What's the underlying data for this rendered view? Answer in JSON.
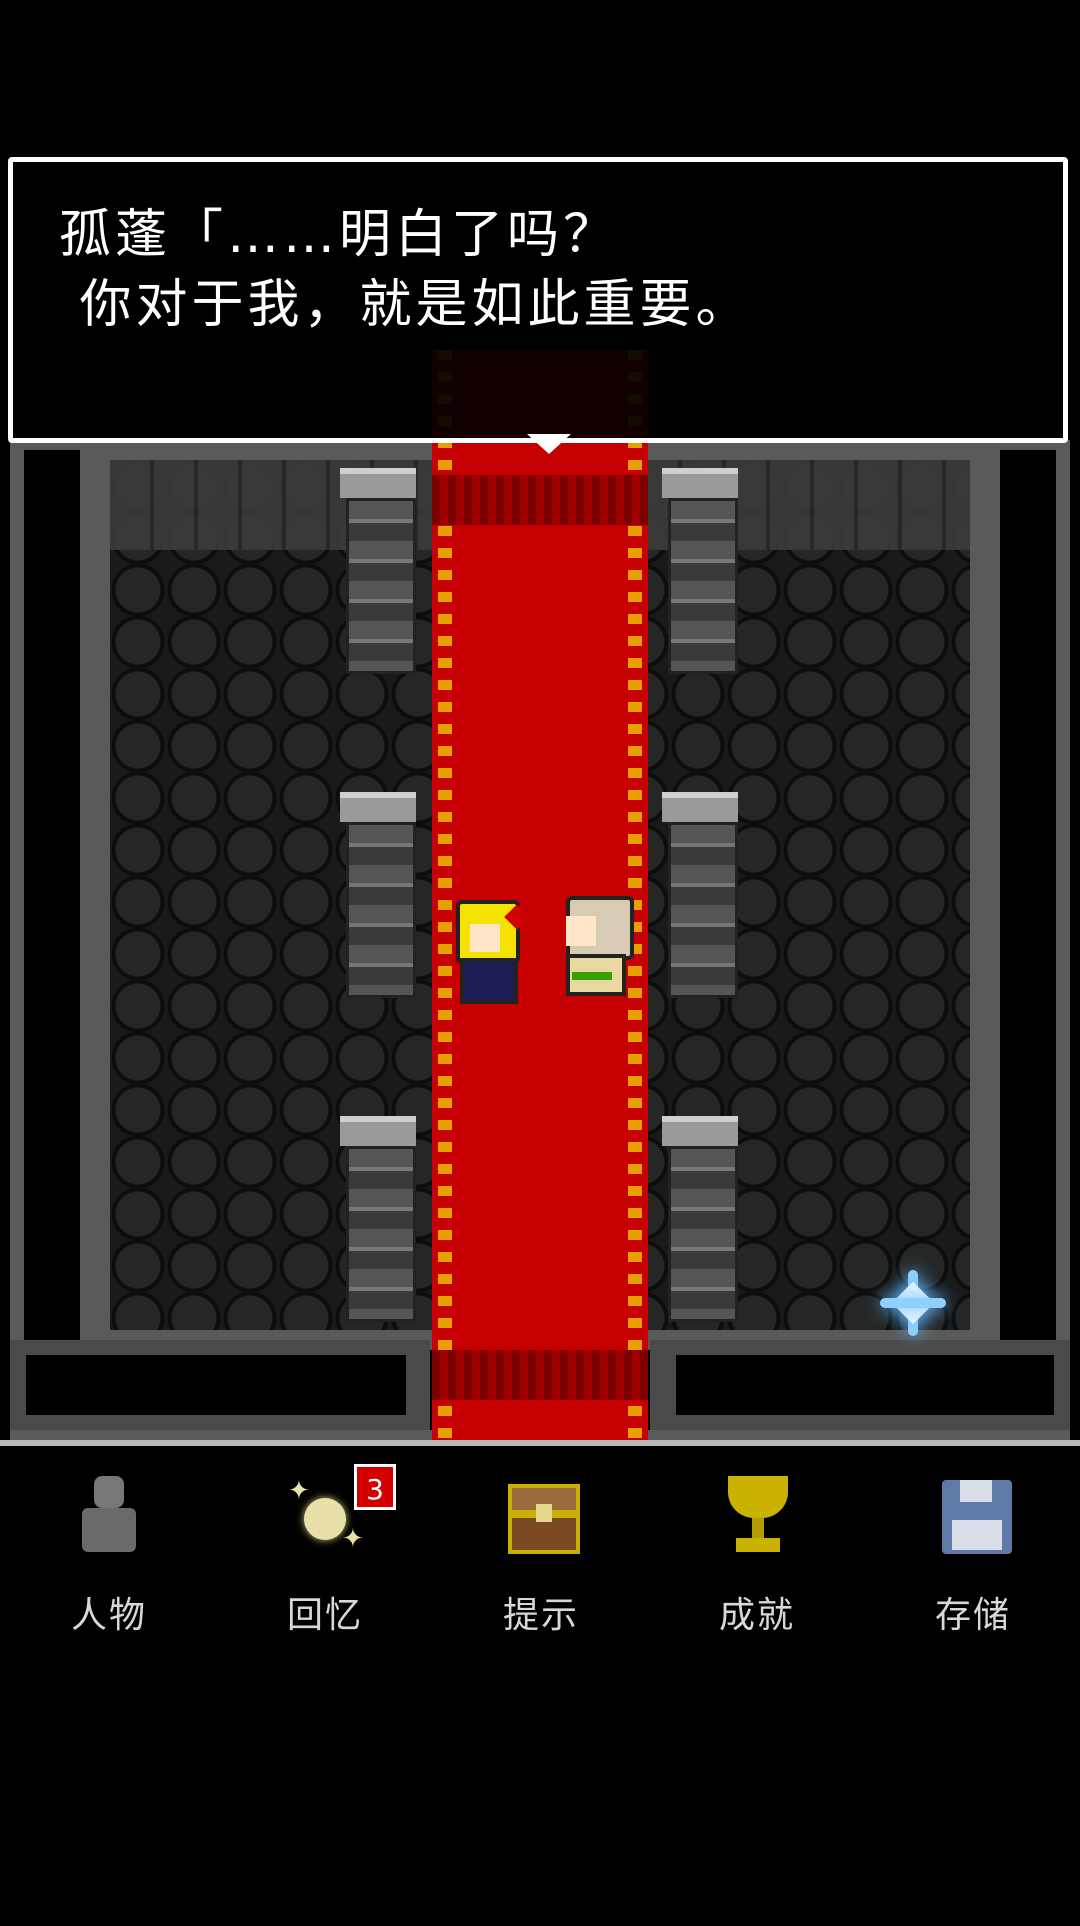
{
  "dialog": {
    "line1": "孤蓬「……明白了吗？",
    "line2": " 你对于我，就是如此重要。"
  },
  "nav": {
    "items": [
      {
        "label": "人物",
        "icon": "person-icon"
      },
      {
        "label": "回忆",
        "icon": "memory-icon",
        "badge": "3"
      },
      {
        "label": "提示",
        "icon": "treasure-chest-icon"
      },
      {
        "label": "成就",
        "icon": "trophy-icon"
      },
      {
        "label": "存储",
        "icon": "save-disk-icon"
      }
    ]
  },
  "colors": {
    "carpet": "#c60000",
    "badge": "#d40000",
    "sparkle": "#8fd0ff"
  }
}
